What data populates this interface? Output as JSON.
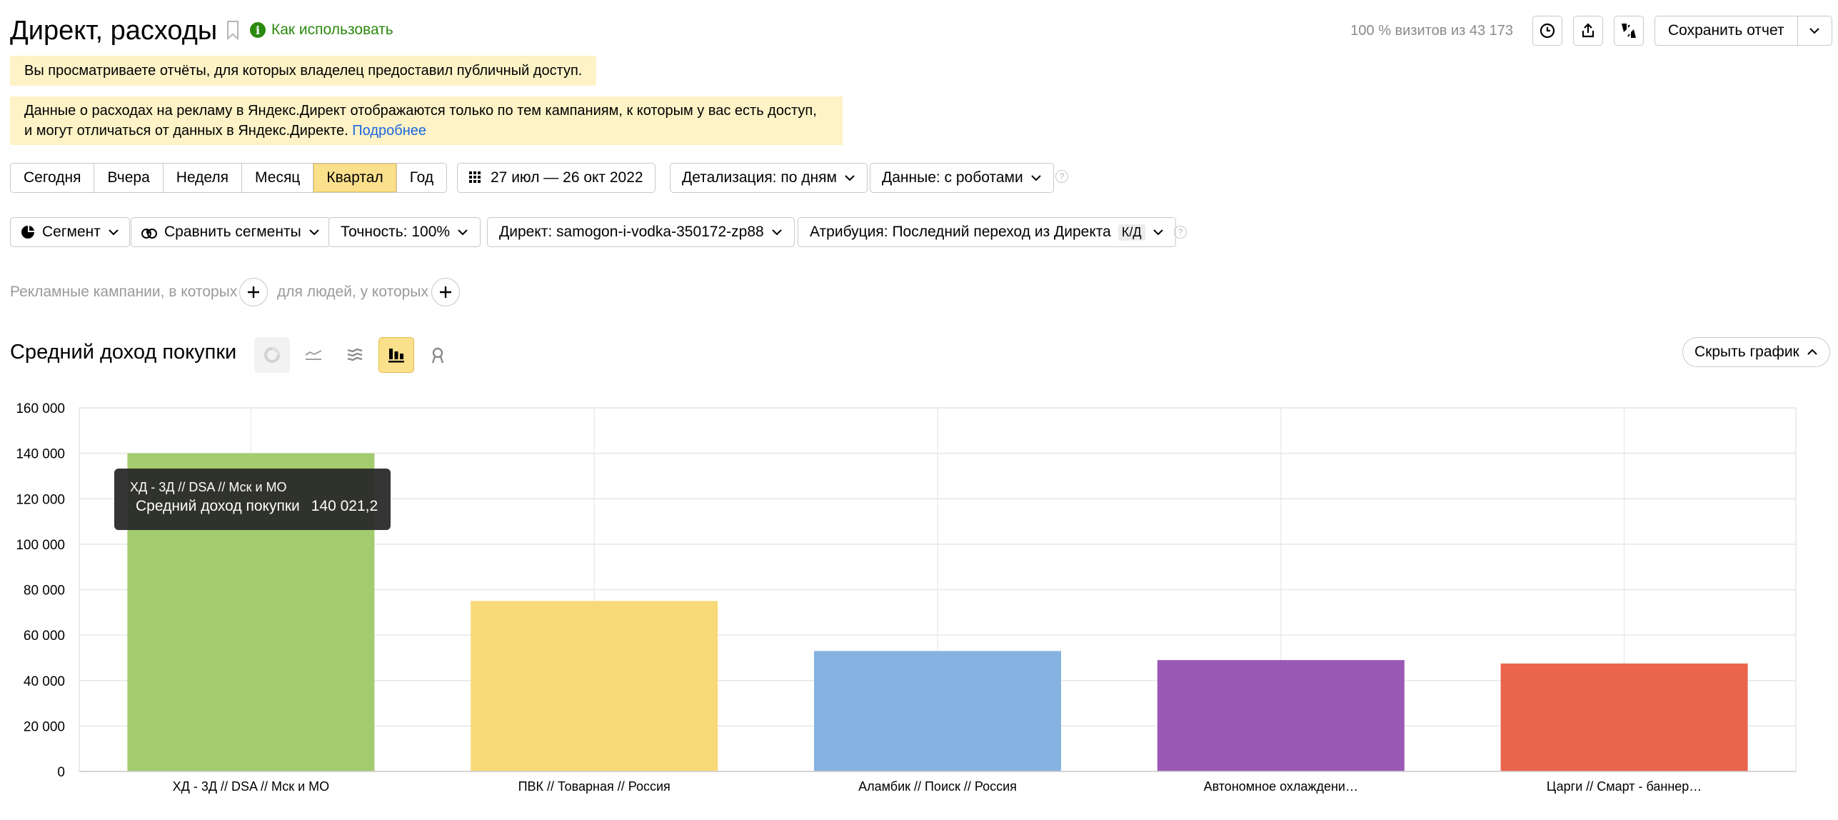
{
  "header": {
    "title": "Директ, расходы",
    "how_to_use": "Как использовать",
    "visits": "100 % визитов из 43 173",
    "save_report": "Сохранить отчет"
  },
  "notices": {
    "public_access": "Вы просматриваете отчёты, для которых владелец предоставил публичный доступ.",
    "direct_line1": "Данные о расходах на рекламу в Яндекс.Директ отображаются только по тем кампаниям, к которым у вас есть доступ,",
    "direct_line2": "и могут отличаться от данных в Яндекс.Директе.",
    "more_link": "Подробнее"
  },
  "period": {
    "items": [
      "Сегодня",
      "Вчера",
      "Неделя",
      "Месяц",
      "Квартал",
      "Год"
    ],
    "active": "Квартал",
    "date_range": "27 июл — 26 окт 2022",
    "detail": "Детализация: по дням",
    "data_mode": "Данные: с роботами"
  },
  "controls": {
    "segment": "Сегмент",
    "compare": "Сравнить сегменты",
    "accuracy": "Точность: 100%",
    "direct": "Директ: samogon-i-vodka-350172-zp88",
    "attribution": "Атрибуция: Последний переход из Директа",
    "attribution_badge": "К/Д"
  },
  "filter": {
    "campaigns_text": "Рекламные кампании, в которых",
    "people_text": "для людей, у которых"
  },
  "chart_section": {
    "title": "Средний доход покупки",
    "hide_chart": "Скрыть график"
  },
  "tooltip": {
    "title": "ХД - 3Д // DSA // Мск и МО",
    "metric": "Средний доход покупки",
    "value": "140 021,2"
  },
  "chart_data": {
    "type": "bar",
    "categories": [
      "ХД - 3Д // DSA // Мск и МО",
      "ПВК // Товарная // Россия",
      "Аламбик // Поиск // Россия",
      "Автономное охлаждени…",
      "Царги // Смарт - баннер…"
    ],
    "values": [
      140021.2,
      75000,
      53000,
      49000,
      47500
    ],
    "colors": [
      "#a3cc6f",
      "#f8d978",
      "#86b2e1",
      "#9b59b6",
      "#ea654b"
    ],
    "ylim": [
      0,
      160000
    ],
    "yticks": [
      0,
      20000,
      40000,
      60000,
      80000,
      100000,
      120000,
      140000,
      160000
    ],
    "ytick_labels": [
      "0",
      "20 000",
      "40 000",
      "60 000",
      "80 000",
      "100 000",
      "120 000",
      "140 000",
      "160 000"
    ],
    "grid": true
  }
}
